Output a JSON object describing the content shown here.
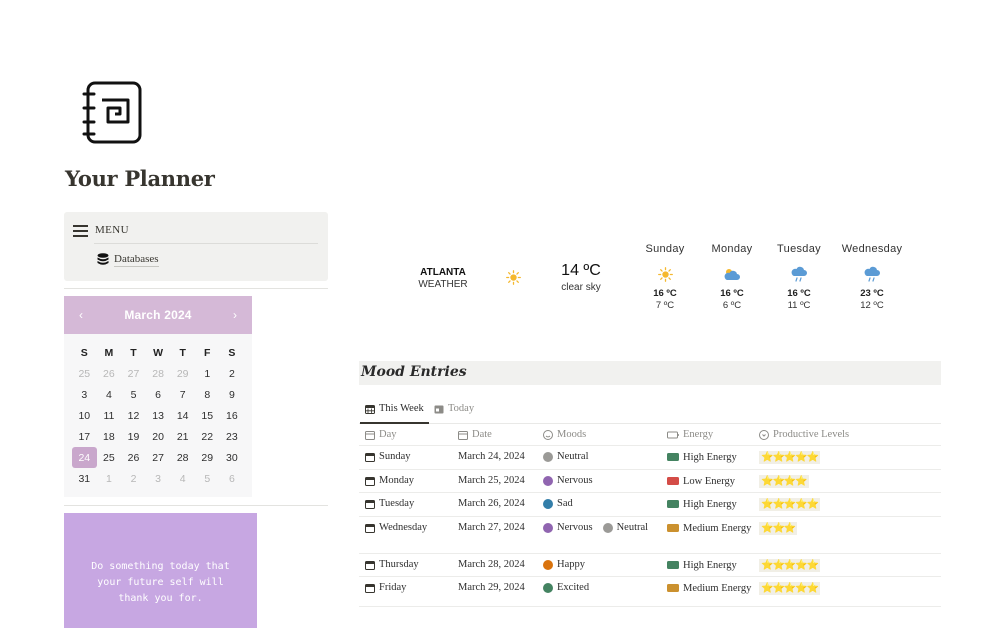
{
  "page": {
    "title": "Your Planner",
    "icon": "notebook-icon"
  },
  "menu": {
    "label": "MENU",
    "items": [
      {
        "label": "Databases",
        "icon": "database-icon"
      }
    ]
  },
  "calendar": {
    "title": "March 2024",
    "prev": "‹",
    "next": "›",
    "weekdays": [
      "S",
      "M",
      "T",
      "W",
      "T",
      "F",
      "S"
    ],
    "weeks": [
      [
        "25",
        "26",
        "27",
        "28",
        "29",
        "1",
        "2"
      ],
      [
        "3",
        "4",
        "5",
        "6",
        "7",
        "8",
        "9"
      ],
      [
        "10",
        "11",
        "12",
        "13",
        "14",
        "15",
        "16"
      ],
      [
        "17",
        "18",
        "19",
        "20",
        "21",
        "22",
        "23"
      ],
      [
        "24",
        "25",
        "26",
        "27",
        "28",
        "29",
        "30"
      ],
      [
        "31",
        "1",
        "2",
        "3",
        "4",
        "5",
        "6"
      ]
    ],
    "today": "24",
    "accent": "#d5b9d7"
  },
  "quote": {
    "text": "Do something today that your future self will thank you for."
  },
  "weather": {
    "city": "ATLANTA",
    "label": "WEATHER",
    "current": {
      "temp": "14 ºC",
      "desc": "clear sky",
      "icon": "sun-icon"
    },
    "days": [
      {
        "name": "Sunday",
        "high": "16 ºC",
        "low": "7 ºC",
        "icon": "sun-icon"
      },
      {
        "name": "Monday",
        "high": "16 ºC",
        "low": "6 ºC",
        "icon": "partly-cloudy-icon"
      },
      {
        "name": "Tuesday",
        "high": "16 ºC",
        "low": "11 ºC",
        "icon": "rain-cloud-icon"
      },
      {
        "name": "Wednesday",
        "high": "23 ºC",
        "low": "12 ºC",
        "icon": "rain-cloud-icon"
      }
    ]
  },
  "mood": {
    "title": "Mood Entries",
    "tabs": [
      {
        "label": "This Week",
        "active": true
      },
      {
        "label": "Today",
        "active": false
      }
    ],
    "columns": {
      "day": "Day",
      "date": "Date",
      "moods": "Moods",
      "energy": "Energy",
      "productive": "Productive Levels"
    },
    "rows": [
      {
        "day": "Sunday",
        "date": "March 24, 2024",
        "moods": [
          {
            "label": "Neutral",
            "color": "#9b9a97"
          }
        ],
        "energy": "High Energy",
        "energy_color": "#448361",
        "stars": "⭐⭐⭐⭐⭐"
      },
      {
        "day": "Monday",
        "date": "March 25, 2024",
        "moods": [
          {
            "label": "Nervous",
            "color": "#9065b0"
          }
        ],
        "energy": "Low Energy",
        "energy_color": "#d44c47",
        "stars": "⭐⭐⭐⭐"
      },
      {
        "day": "Tuesday",
        "date": "March 26, 2024",
        "moods": [
          {
            "label": "Sad",
            "color": "#337ea9"
          }
        ],
        "energy": "High Energy",
        "energy_color": "#448361",
        "stars": "⭐⭐⭐⭐⭐"
      },
      {
        "day": "Wednesday",
        "date": "March 27, 2024",
        "moods": [
          {
            "label": "Nervous",
            "color": "#9065b0"
          },
          {
            "label": "Neutral",
            "color": "#9b9a97"
          }
        ],
        "energy": "Medium Energy",
        "energy_color": "#cb912f",
        "stars": "⭐⭐⭐"
      },
      {
        "day": "Thursday",
        "date": "March 28, 2024",
        "moods": [
          {
            "label": "Happy",
            "color": "#d9730d"
          }
        ],
        "energy": "High Energy",
        "energy_color": "#448361",
        "stars": "⭐⭐⭐⭐⭐"
      },
      {
        "day": "Friday",
        "date": "March 29, 2024",
        "moods": [
          {
            "label": "Excited",
            "color": "#448361"
          }
        ],
        "energy": "Medium Energy",
        "energy_color": "#cb912f",
        "stars": "⭐⭐⭐⭐⭐"
      }
    ]
  }
}
